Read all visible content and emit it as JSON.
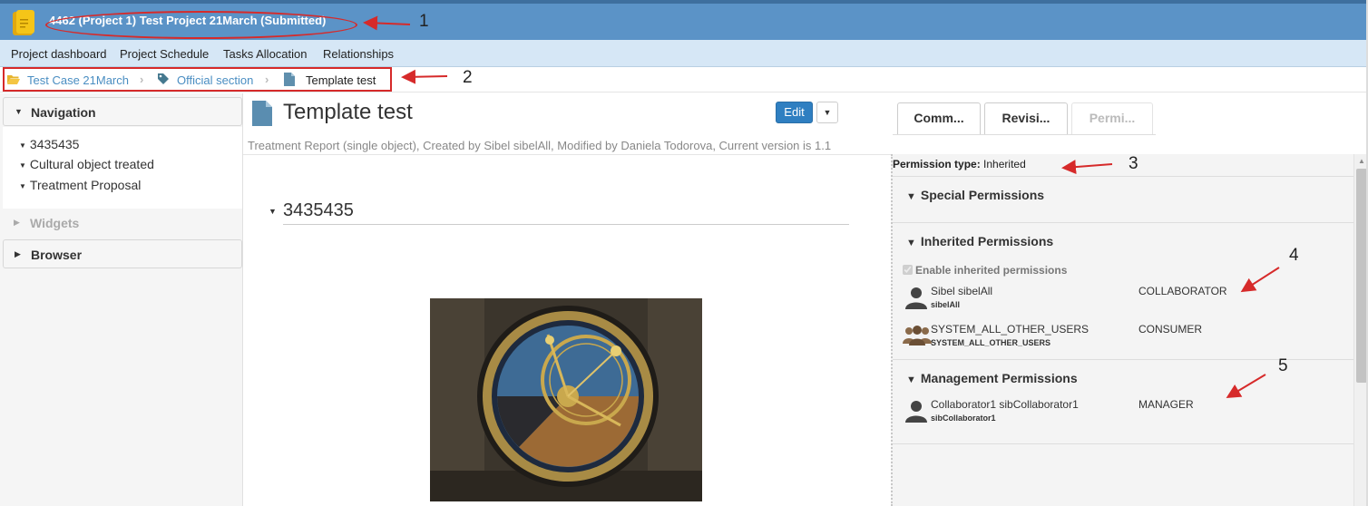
{
  "header": {
    "title": "4462 (Project 1) Test Project 21March (Submitted)",
    "logo_icon": "project-folder-icon"
  },
  "menu": {
    "items": [
      "Project dashboard",
      "Project Schedule",
      "Tasks Allocation",
      "Relationships"
    ]
  },
  "breadcrumb": {
    "items": [
      {
        "label": "Test Case 21March",
        "icon": "folder-open-icon"
      },
      {
        "label": "Official section",
        "icon": "tag-icon"
      },
      {
        "label": "Template test",
        "icon": "document-icon"
      }
    ]
  },
  "sidebar": {
    "navigation_label": "Navigation",
    "nav_items": [
      "3435435",
      "Cultural object treated",
      "Treatment Proposal"
    ],
    "widgets_label": "Widgets",
    "browser_label": "Browser"
  },
  "document": {
    "title": "Template test",
    "edit_label": "Edit",
    "meta": "Treatment Report (single object), Created by Sibel sibelAll, Modified by Daniela Todorova, Current version is 1.1",
    "section_title": "3435435",
    "image_subject": "astronomical-clock-photo"
  },
  "tabs": [
    {
      "label": "Comm...",
      "enabled": true
    },
    {
      "label": "Revisi...",
      "enabled": true
    },
    {
      "label": "Permi...",
      "enabled": false
    }
  ],
  "permissions": {
    "type_label": "Permission type:",
    "type_value": "Inherited",
    "special_label": "Special Permissions",
    "inherited_label": "Inherited Permissions",
    "enable_inherited_label": "Enable inherited permissions",
    "enable_inherited_checked": true,
    "inherited_users": [
      {
        "name": "Sibel sibelAll",
        "login": "sibelAll",
        "role": "COLLABORATOR",
        "icon": "user-icon"
      },
      {
        "name": "SYSTEM_ALL_OTHER_USERS",
        "login": "SYSTEM_ALL_OTHER_USERS",
        "role": "CONSUMER",
        "icon": "group-icon"
      }
    ],
    "management_label": "Management Permissions",
    "management_users": [
      {
        "name": "Collaborator1 sibCollaborator1",
        "login": "sibCollaborator1",
        "role": "MANAGER",
        "icon": "user-icon"
      }
    ]
  },
  "annotations": {
    "labels": [
      "1",
      "2",
      "3",
      "4",
      "5"
    ],
    "color": "#d62a2a"
  },
  "colors": {
    "header_bg": "#5b93c7",
    "menu_bg": "#d6e7f6",
    "link": "#4a8ec2",
    "primary_button": "#2f7fc1"
  }
}
